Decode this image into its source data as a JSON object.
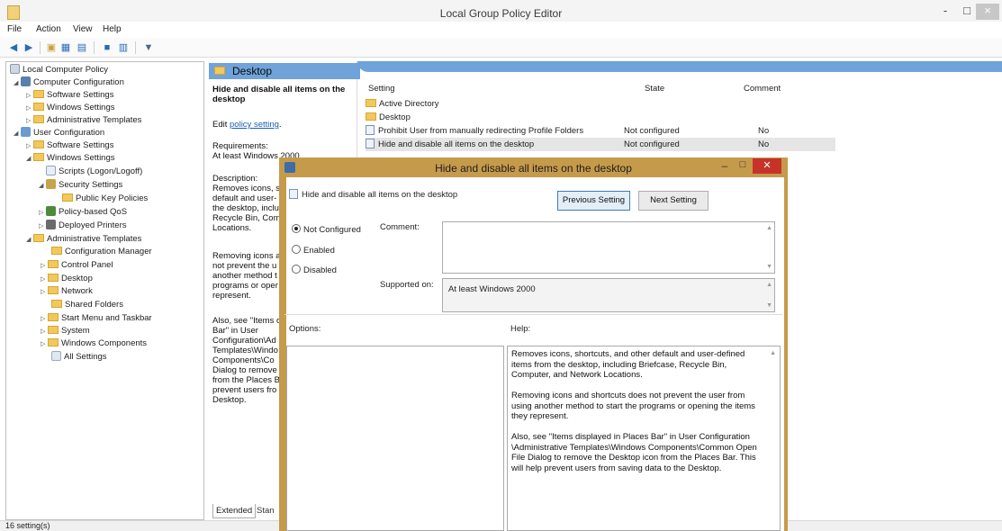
{
  "window": {
    "title": "Local Group Policy Editor",
    "min": "-",
    "max": "□",
    "close": "×"
  },
  "menu": [
    "File",
    "Action",
    "View",
    "Help"
  ],
  "tree": {
    "root": "Local Computer Policy",
    "items": [
      "Computer Configuration",
      "Software Settings",
      "Windows Settings",
      "Administrative Templates",
      "User Configuration",
      "Software Settings",
      "Windows Settings",
      "Scripts (Logon/Logoff)",
      "Security Settings",
      "Public Key Policies",
      "Policy-based QoS",
      "Deployed Printers",
      "Administrative Templates",
      "Configuration Manager",
      "Control Panel",
      "Desktop",
      "Network",
      "Shared Folders",
      "Start Menu and Taskbar",
      "System",
      "Windows Components",
      "All Settings"
    ]
  },
  "desc": {
    "header": "Desktop",
    "title": "Hide and disable all items on the desktop",
    "edit_prefix": "Edit ",
    "edit_link": "policy setting",
    "edit_suffix": ".",
    "requirements_label": "Requirements:",
    "requirements": "At least Windows 2000",
    "description_label": "Description:",
    "p1": "Removes icons, s\ndefault and user-\nthe desktop, inclu\nRecycle Bin, Com\nLocations.",
    "p2": "Removing icons a\nnot prevent the u\nanother method t\nprograms or oper\nrepresent.",
    "p3": "Also, see \"Items d\nBar\" in User\nConfiguration\\Ad\nTemplates\\Windo\nComponents\\Co\nDialog to remove\nfrom the Places B\nprevent users fro\nDesktop.",
    "tab_extended": "Extended",
    "tab_standard": "Stan"
  },
  "list": {
    "columns": [
      "Setting",
      "State",
      "Comment"
    ],
    "rows": [
      {
        "name": "Active Directory",
        "state": "",
        "comment": ""
      },
      {
        "name": "Desktop",
        "state": "",
        "comment": ""
      },
      {
        "name": "Prohibit User from manually redirecting Profile Folders",
        "state": "Not configured",
        "comment": "No"
      },
      {
        "name": "Hide and disable all items on the desktop",
        "state": "Not configured",
        "comment": "No"
      }
    ]
  },
  "status": "16 setting(s)",
  "dialog": {
    "title": "Hide and disable all items on the desktop",
    "setting_name": "Hide and disable all items on the desktop",
    "prev_btn": "Previous Setting",
    "next_btn": "Next Setting",
    "options": [
      "Not Configured",
      "Enabled",
      "Disabled"
    ],
    "selected_option": "Not Configured",
    "comment_label": "Comment:",
    "supported_label": "Supported on:",
    "supported_value": "At least Windows 2000",
    "options_label": "Options:",
    "help_label": "Help:",
    "help": "Removes icons, shortcuts, and other default and user-defined items from the desktop, including Briefcase, Recycle Bin, Computer, and Network Locations.\n\nRemoving icons and shortcuts does not prevent the user from using another method to start the programs or opening the items they represent.\n\nAlso, see \"Items displayed in Places Bar\" in User Configuration \\Administrative Templates\\Windows Components\\Common Open File Dialog to remove the Desktop icon from the Places Bar. This will help prevent users from saving data to the Desktop."
  },
  "colors": {
    "accent": "#6fa3d9",
    "dialog_frame": "#c69a4b",
    "close_red": "#c7332a"
  }
}
